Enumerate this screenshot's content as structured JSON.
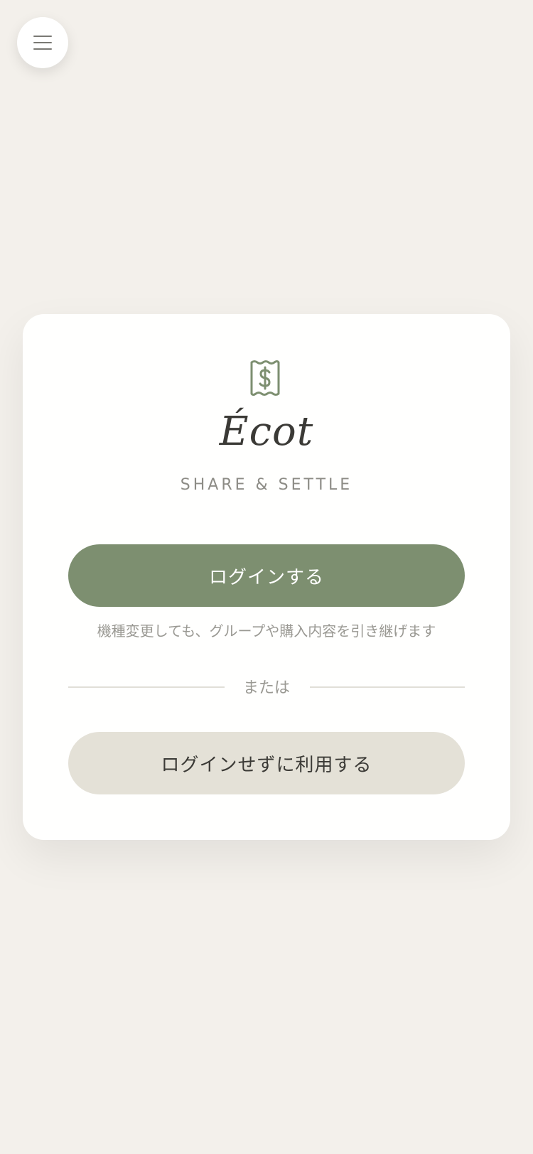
{
  "header": {
    "menu_icon": "hamburger-menu-icon"
  },
  "brand": {
    "logo_icon": "receipt-dollar-icon",
    "title": "Écot",
    "tagline": "SHARE & SETTLE"
  },
  "auth": {
    "login_label": "ログインする",
    "login_hint": "機種変更しても、グループや購入内容を引き継げます",
    "divider_label": "または",
    "guest_label": "ログインせずに利用する"
  },
  "colors": {
    "background": "#f3f0eb",
    "card": "#fffffe",
    "primary": "#7d8f70",
    "secondary": "#e4e1d7",
    "text_dark": "#3b3a36",
    "text_muted": "#9a9993"
  }
}
